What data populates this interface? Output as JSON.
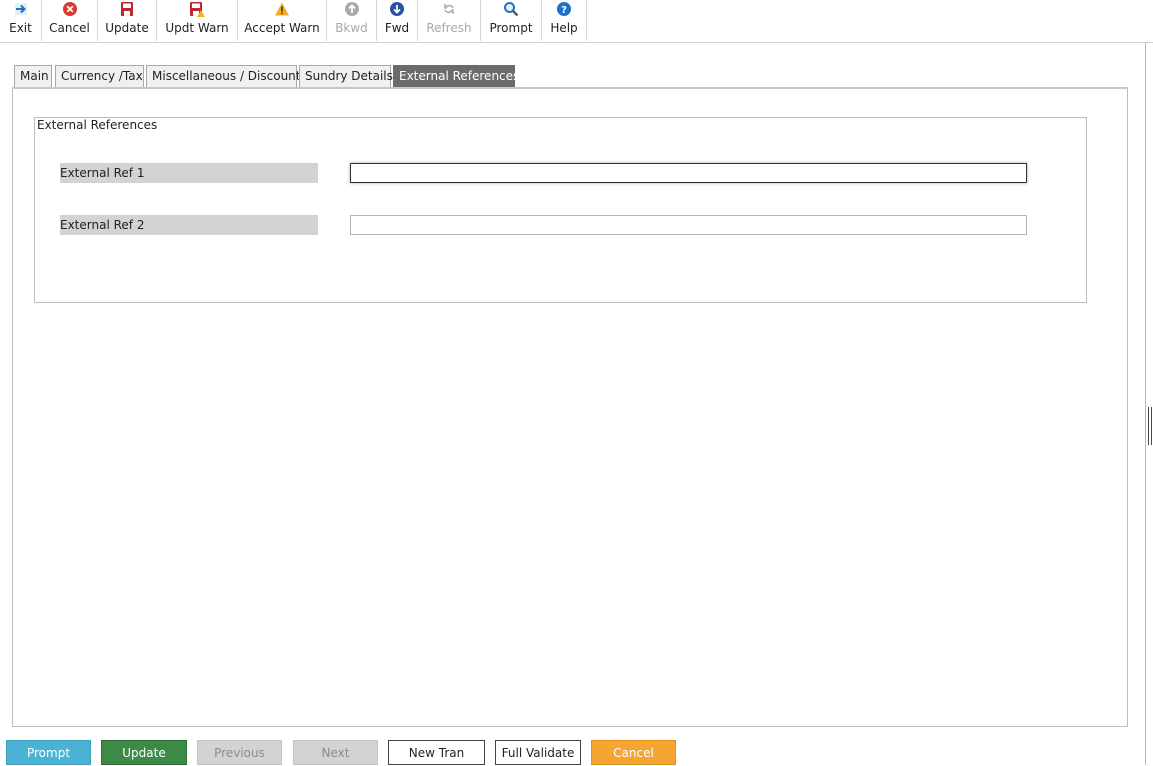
{
  "toolbar": [
    {
      "label": "Exit",
      "icon": "exit-icon",
      "color": "#1a73c9",
      "disabled": false
    },
    {
      "label": "Cancel",
      "icon": "cancel-icon",
      "color": "#d93a2b",
      "disabled": false
    },
    {
      "label": "Update",
      "icon": "save-icon",
      "color": "#c0272d",
      "disabled": false
    },
    {
      "label": "Updt Warn",
      "icon": "save-warning-icon",
      "color": "#c0272d",
      "disabled": false
    },
    {
      "label": "Accept Warn",
      "icon": "warning-icon",
      "color": "#f2b01e",
      "disabled": false
    },
    {
      "label": "Bkwd",
      "icon": "arrow-up-circle-icon",
      "color": "#a9a9a9",
      "disabled": true
    },
    {
      "label": "Fwd",
      "icon": "arrow-down-circle-icon",
      "color": "#2d4fa8",
      "disabled": false
    },
    {
      "label": "Refresh",
      "icon": "refresh-icon",
      "color": "#a9a9a9",
      "disabled": true
    },
    {
      "label": "Prompt",
      "icon": "magnifier-icon",
      "color": "#1a73c9",
      "disabled": false
    },
    {
      "label": "Help",
      "icon": "help-icon",
      "color": "#1a73c9",
      "disabled": false
    }
  ],
  "tabs": [
    {
      "label": "Main",
      "active": false
    },
    {
      "label": "Currency /Tax",
      "active": false
    },
    {
      "label": "Miscellaneous / Discount",
      "active": false
    },
    {
      "label": "Sundry Details",
      "active": false
    },
    {
      "label": "External References",
      "active": true
    }
  ],
  "group": {
    "legend": "External References",
    "fields": [
      {
        "label": "External Ref 1",
        "value": ""
      },
      {
        "label": "External Ref 2",
        "value": ""
      }
    ]
  },
  "bottom_buttons": [
    {
      "label": "Prompt",
      "style": "info",
      "bg": "#4bb2d4",
      "fg": "#ffffff"
    },
    {
      "label": "Update",
      "style": "success",
      "bg": "#3d8a47",
      "fg": "#ffffff"
    },
    {
      "label": "Previous",
      "style": "disabled",
      "bg": "#d3d3d3",
      "fg": "#8c8c8c"
    },
    {
      "label": "Next",
      "style": "disabled",
      "bg": "#d3d3d3",
      "fg": "#8c8c8c"
    },
    {
      "label": "New Tran",
      "style": "default",
      "bg": "#ffffff",
      "fg": "#222222"
    },
    {
      "label": "Full Validate",
      "style": "default",
      "bg": "#ffffff",
      "fg": "#222222"
    },
    {
      "label": "Cancel",
      "style": "warning",
      "bg": "#f4a532",
      "fg": "#ffffff"
    }
  ]
}
